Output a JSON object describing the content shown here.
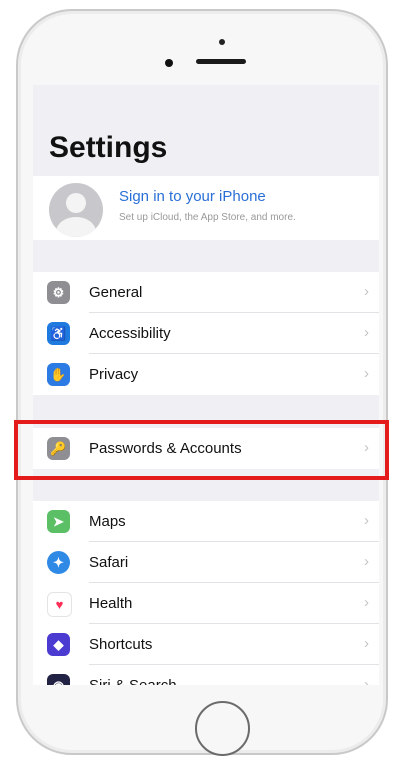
{
  "settings": {
    "title": "Settings",
    "profile": {
      "title": "Sign in to your iPhone",
      "subtitle": "Set up iCloud, the App Store, and more."
    },
    "groups": [
      [
        {
          "label": "General",
          "icon": "gear-icon",
          "color": "#8e8e93"
        },
        {
          "label": "Accessibility",
          "icon": "accessibility-icon",
          "color": "#1f7ae0"
        },
        {
          "label": "Privacy",
          "icon": "hand-icon",
          "color": "#2c7be5"
        }
      ],
      [
        {
          "label": "Passwords & Accounts",
          "icon": "key-icon",
          "color": "#8e8e93"
        }
      ],
      [
        {
          "label": "Maps",
          "icon": "maps-icon",
          "color": "#5bbf66"
        },
        {
          "label": "Safari",
          "icon": "compass-icon",
          "color": "#2f8ae6"
        },
        {
          "label": "Health",
          "icon": "heart-icon",
          "color": "#ff2d55"
        },
        {
          "label": "Shortcuts",
          "icon": "shortcuts-icon",
          "color": "#4b3bd0"
        },
        {
          "label": "Siri & Search",
          "icon": "siri-icon",
          "color": "#222244"
        }
      ]
    ]
  },
  "highlight": {
    "color": "#e41b1b"
  }
}
